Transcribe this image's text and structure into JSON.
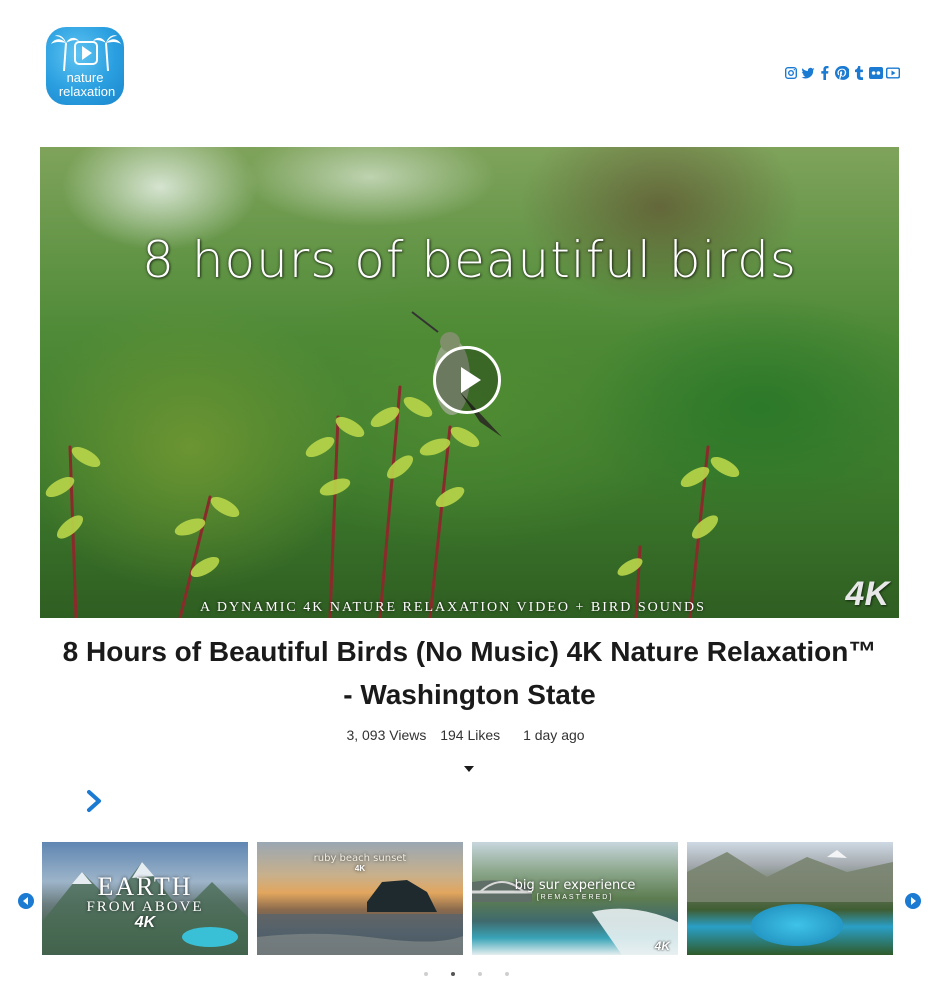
{
  "logo": {
    "line1": "nature",
    "line2": "relaxation"
  },
  "social": [
    {
      "icon": "instagram-icon"
    },
    {
      "icon": "twitter-icon"
    },
    {
      "icon": "facebook-icon"
    },
    {
      "icon": "pinterest-icon"
    },
    {
      "icon": "tumblr-icon"
    },
    {
      "icon": "flickr-icon"
    },
    {
      "icon": "youtube-icon"
    }
  ],
  "accent_color": "#1b7ad1",
  "hero": {
    "overlay_title": "8 hours of beautiful birds",
    "overlay_subtitle": "A DYNAMIC 4K NATURE RELAXATION VIDEO + BIRD SOUNDS",
    "badge": "4K"
  },
  "video": {
    "title": "8 Hours of Beautiful Birds (No Music) 4K Nature Relaxation™ - Washington State",
    "views": "3, 093 Views",
    "likes": "194 Likes",
    "age": "1 day ago"
  },
  "carousel": {
    "thumbs": [
      {
        "line1": "EARTH",
        "line2": "FROM ABOVE",
        "line3": "4K"
      },
      {
        "line1": "ruby beach sunset",
        "line2": "4K"
      },
      {
        "line1": "big sur experience",
        "line2": "[REMASTERED]",
        "line3": "4K"
      },
      {
        "line1": ""
      }
    ],
    "dots": 4,
    "active_dot": 1
  }
}
